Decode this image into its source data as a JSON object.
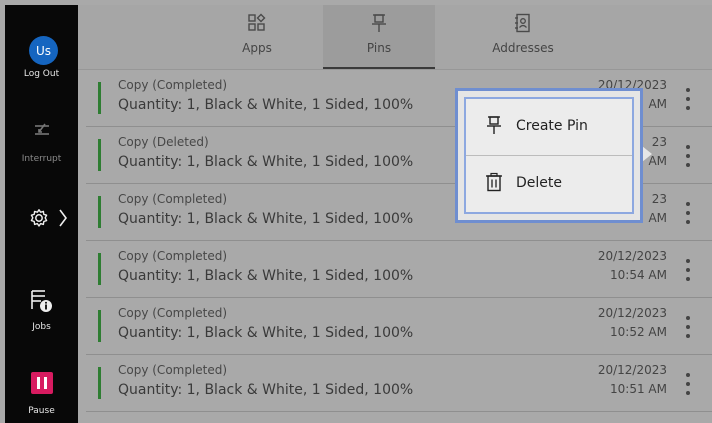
{
  "sidebar": {
    "avatar_initials": "Us",
    "logout_label": "Log Out",
    "interrupt_label": "Interrupt",
    "jobs_label": "Jobs",
    "pause_label": "Pause"
  },
  "tabs": [
    {
      "label": "Apps",
      "icon": "apps-icon"
    },
    {
      "label": "Pins",
      "icon": "pin-icon",
      "active": true
    },
    {
      "label": "Addresses",
      "icon": "address-book-icon"
    }
  ],
  "jobs": [
    {
      "title": "Copy (Completed)",
      "detail": "Quantity: 1, Black & White, 1 Sided, 100%",
      "date": "20/12/2023",
      "time": "AM"
    },
    {
      "title": "Copy (Deleted)",
      "detail": "Quantity: 1, Black & White, 1 Sided, 100%",
      "date": "23",
      "time": "AM"
    },
    {
      "title": "Copy (Completed)",
      "detail": "Quantity: 1, Black & White, 1 Sided, 100%",
      "date": "23",
      "time": "AM"
    },
    {
      "title": "Copy (Completed)",
      "detail": "Quantity: 1, Black & White, 1 Sided, 100%",
      "date": "20/12/2023",
      "time": "10:54 AM"
    },
    {
      "title": "Copy (Completed)",
      "detail": "Quantity: 1, Black & White, 1 Sided, 100%",
      "date": "20/12/2023",
      "time": "10:52 AM"
    },
    {
      "title": "Copy (Completed)",
      "detail": "Quantity: 1, Black & White, 1 Sided, 100%",
      "date": "20/12/2023",
      "time": "10:51 AM"
    }
  ],
  "popup": {
    "create_pin_label": "Create Pin",
    "delete_label": "Delete"
  },
  "colors": {
    "accent_blue": "#1565c0",
    "status_green": "#2e7d32",
    "pause_red": "#d81b60"
  }
}
